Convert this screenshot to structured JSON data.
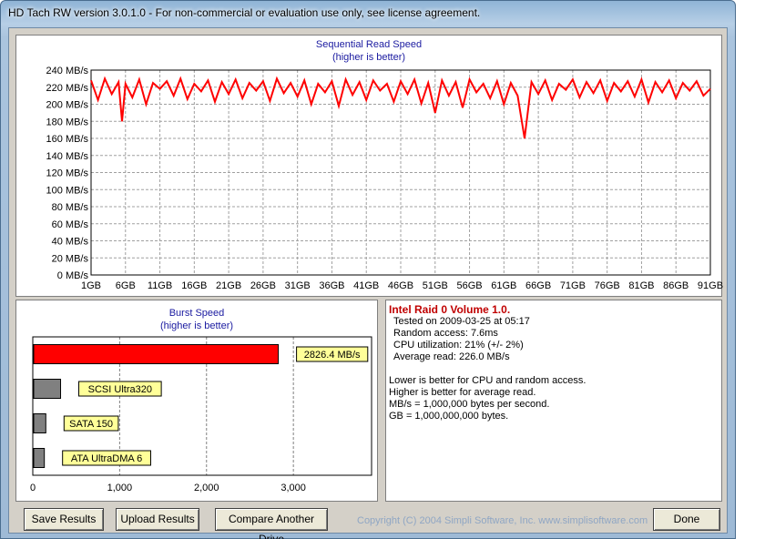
{
  "window": {
    "title": "HD Tach RW version 3.0.1.0  - For non-commercial or evaluation use only, see license agreement."
  },
  "sequential": {
    "title": "Sequential Read Speed",
    "subtitle": "(higher is better)"
  },
  "burst": {
    "title": "Burst Speed",
    "subtitle": "(higher is better)"
  },
  "chart_data": [
    {
      "type": "line",
      "title": "Sequential Read Speed",
      "subtitle": "(higher is better)",
      "xlabel": "",
      "ylabel": "",
      "x_ticks": [
        "1GB",
        "6GB",
        "11GB",
        "16GB",
        "21GB",
        "26GB",
        "31GB",
        "36GB",
        "41GB",
        "46GB",
        "51GB",
        "56GB",
        "61GB",
        "66GB",
        "71GB",
        "76GB",
        "81GB",
        "86GB",
        "91GB"
      ],
      "y_ticks": [
        "0 MB/s",
        "20 MB/s",
        "40 MB/s",
        "60 MB/s",
        "80 MB/s",
        "100 MB/s",
        "120 MB/s",
        "140 MB/s",
        "160 MB/s",
        "180 MB/s",
        "200 MB/s",
        "220 MB/s",
        "240 MB/s"
      ],
      "xlim": [
        1,
        91
      ],
      "ylim": [
        0,
        240
      ],
      "grid": true,
      "color": "#ff0000",
      "series": [
        {
          "x": [
            1,
            2,
            3,
            4,
            5,
            5.5,
            6,
            7,
            8,
            9,
            10,
            11,
            12,
            13,
            14,
            15,
            16,
            17,
            18,
            19,
            20,
            21,
            22,
            23,
            24,
            25,
            26,
            27,
            28,
            29,
            30,
            31,
            32,
            33,
            34,
            35,
            36,
            37,
            38,
            39,
            40,
            41,
            42,
            43,
            44,
            45,
            46,
            47,
            48,
            49,
            50,
            51,
            52,
            53,
            54,
            55,
            56,
            57,
            58,
            59,
            60,
            61,
            62,
            63,
            64,
            65,
            66,
            67,
            68,
            69,
            70,
            71,
            72,
            73,
            74,
            75,
            76,
            77,
            78,
            79,
            80,
            81,
            82,
            83,
            84,
            85,
            86,
            87,
            88,
            89,
            90,
            91
          ],
          "y": [
            228,
            205,
            230,
            212,
            226,
            180,
            224,
            208,
            229,
            200,
            225,
            218,
            227,
            210,
            230,
            206,
            224,
            215,
            228,
            203,
            226,
            212,
            229,
            207,
            225,
            216,
            227,
            204,
            230,
            213,
            225,
            209,
            228,
            200,
            224,
            214,
            227,
            198,
            229,
            211,
            226,
            205,
            228,
            216,
            224,
            203,
            227,
            212,
            229,
            201,
            225,
            190,
            228,
            210,
            226,
            196,
            229,
            214,
            224,
            207,
            227,
            200,
            225,
            210,
            160,
            226,
            212,
            228,
            205,
            224,
            217,
            229,
            208,
            226,
            213,
            228,
            204,
            225,
            215,
            227,
            209,
            229,
            202,
            226,
            214,
            228,
            207,
            225,
            216,
            227,
            210,
            218
          ]
        }
      ]
    },
    {
      "type": "bar",
      "title": "Burst Speed",
      "subtitle": "(higher is better)",
      "orientation": "horizontal",
      "xlim": [
        0,
        3900
      ],
      "x_ticks": [
        "0",
        "1,000",
        "2,000",
        "3,000"
      ],
      "grid": true,
      "categories": [
        "2826.4 MB/s",
        "SCSI Ultra320",
        "SATA 150",
        "ATA UltraDMA 6"
      ],
      "values": [
        2826.4,
        320,
        150,
        133
      ],
      "colors": [
        "#ff0000",
        "#808080",
        "#808080",
        "#808080"
      ],
      "label_bg": "#ffff99"
    }
  ],
  "info": {
    "title": "Intel Raid 0 Volume 1.0.",
    "tested": "Tested on 2009-03-25 at 05:17",
    "random_access": "Random access: 7.6ms",
    "cpu": "CPU utilization: 21% (+/- 2%)",
    "average_read": "Average read: 226.0 MB/s",
    "notes": [
      "Lower is better for CPU and random access.",
      "Higher is better for average read.",
      "MB/s = 1,000,000 bytes per second.",
      "GB = 1,000,000,000 bytes."
    ]
  },
  "buttons": {
    "save": "Save Results",
    "upload": "Upload Results",
    "compare": "Compare Another Drive",
    "done": "Done"
  },
  "footer": {
    "copyright": "Copyright (C) 2004 Simpli Software, Inc. www.simplisoftware.com"
  }
}
